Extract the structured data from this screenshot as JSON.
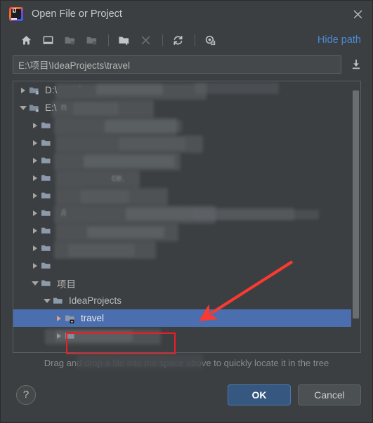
{
  "window": {
    "title": "Open File or Project",
    "app_icon": "intellij-idea-logo",
    "close_icon": "close-icon"
  },
  "toolbar": {
    "buttons": [
      {
        "name": "home-icon",
        "label": "Home",
        "enabled": true
      },
      {
        "name": "desktop-icon",
        "label": "Desktop",
        "enabled": true
      },
      {
        "name": "folder-up-icon",
        "label": "Up",
        "enabled": false
      },
      {
        "name": "folder-project-icon",
        "label": "Project Directory",
        "enabled": false
      },
      {
        "name": "new-folder-icon",
        "label": "New Folder",
        "enabled": true
      },
      {
        "name": "delete-icon",
        "label": "Delete",
        "enabled": false
      },
      {
        "name": "refresh-icon",
        "label": "Refresh",
        "enabled": true
      },
      {
        "name": "show-hidden-icon",
        "label": "Show Hidden Files",
        "enabled": true
      }
    ],
    "hide_path_label": "Hide path"
  },
  "path_field": {
    "value": "E:\\项目\\IdeaProjects\\travel",
    "placeholder": "",
    "download_icon": "download-arrow-icon"
  },
  "tree": {
    "rows": [
      {
        "label": "D:\\",
        "indent": 0,
        "arrow": "collapsed",
        "icon": "drive-folder-icon",
        "redacted": false,
        "selected": false
      },
      {
        "label": "E:\\",
        "indent": 0,
        "arrow": "expanded",
        "icon": "drive-folder-icon",
        "redacted": false,
        "selected": false
      },
      {
        "label": "",
        "indent": 1,
        "arrow": "collapsed",
        "icon": "folder-icon",
        "redacted": true,
        "selected": false
      },
      {
        "label": "",
        "indent": 1,
        "arrow": "collapsed",
        "icon": "folder-icon",
        "redacted": true,
        "selected": false
      },
      {
        "label": "",
        "indent": 1,
        "arrow": "collapsed",
        "icon": "folder-icon",
        "redacted": true,
        "selected": false
      },
      {
        "label": "",
        "indent": 1,
        "arrow": "collapsed",
        "icon": "folder-icon",
        "redacted": true,
        "selected": false
      },
      {
        "label": "",
        "indent": 1,
        "arrow": "collapsed",
        "icon": "folder-icon",
        "redacted": true,
        "selected": false
      },
      {
        "label": "",
        "indent": 1,
        "arrow": "collapsed",
        "icon": "folder-icon",
        "redacted": true,
        "selected": false
      },
      {
        "label": "",
        "indent": 1,
        "arrow": "collapsed",
        "icon": "folder-icon",
        "redacted": true,
        "selected": false
      },
      {
        "label": "",
        "indent": 1,
        "arrow": "collapsed",
        "icon": "folder-icon",
        "redacted": true,
        "selected": false
      },
      {
        "label": "",
        "indent": 1,
        "arrow": "collapsed",
        "icon": "folder-icon",
        "redacted": true,
        "selected": false
      },
      {
        "label": "项目",
        "indent": 1,
        "arrow": "expanded",
        "icon": "folder-icon",
        "redacted": false,
        "selected": false
      },
      {
        "label": "IdeaProjects",
        "indent": 2,
        "arrow": "expanded",
        "icon": "folder-icon",
        "redacted": false,
        "selected": false
      },
      {
        "label": "travel",
        "indent": 3,
        "arrow": "collapsed",
        "icon": "module-folder-icon",
        "redacted": false,
        "selected": true
      },
      {
        "label": "",
        "indent": 3,
        "arrow": "collapsed",
        "icon": "folder-icon",
        "redacted": true,
        "selected": false
      }
    ],
    "scrollbar_name": "tree-vertical-scrollbar"
  },
  "hint": {
    "text": "Drag and drop a file into the space above to quickly locate it in the tree"
  },
  "footer": {
    "help_label": "?",
    "ok_label": "OK",
    "cancel_label": "Cancel"
  },
  "annotations": {
    "highlight_box": {
      "target": "travel",
      "color": "#ee1c25"
    },
    "arrow": {
      "points_to": "travel-row",
      "color": "#f93a32"
    }
  },
  "colors": {
    "window_bg": "#3c3f41",
    "selection": "#4b6eaf",
    "link": "#4a88d6",
    "primary_button": "#365880",
    "annotation_red": "#ee1c25"
  }
}
